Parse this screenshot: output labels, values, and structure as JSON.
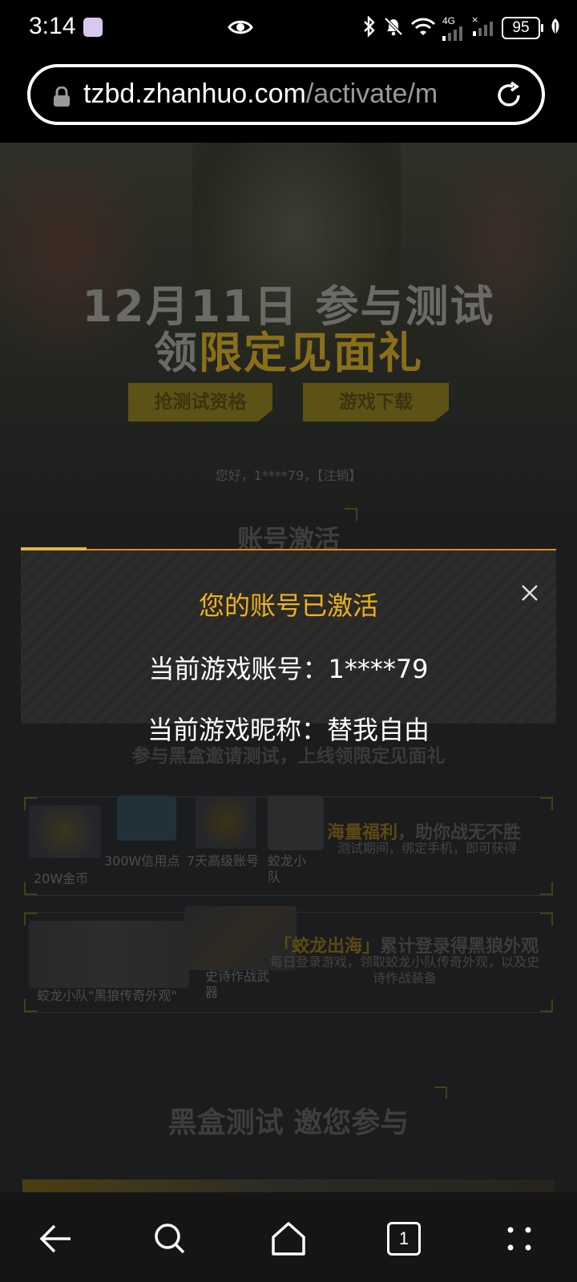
{
  "status_bar": {
    "time": "3:14",
    "battery": "95",
    "network_label": "4G",
    "icons": [
      "eye-icon",
      "bluetooth-icon",
      "mute-icon",
      "wifi-icon",
      "signal-icon",
      "signal-icon",
      "battery-icon",
      "leaf-icon"
    ]
  },
  "browser": {
    "url_host": "tzbd.zhanhuo.com",
    "url_path": "/activate/m",
    "tab_count": "1"
  },
  "page": {
    "headline_line1": "12月11日 参与测试",
    "headline_line2_prefix": "领",
    "headline_line2_gold": "限定见面礼",
    "cta_qualify": "抢测试资格",
    "cta_download": "游戏下载",
    "greeting": "您好，1****79，【注销】",
    "section_account_activation": "账号激活",
    "invite_title": "参与黑盒邀请测试，上线领限定见面礼",
    "rewards1": {
      "items": [
        "20W金币",
        "300W信用点",
        "7天高级账号",
        "蛟龙小队"
      ],
      "title_highlight": "海量福利",
      "title_rest": "，助你战无不胜",
      "desc": "测试期间，绑定手机，即可获得"
    },
    "rewards2": {
      "items": [
        "蛟龙小队\"黑狼传奇外观\"",
        "史诗作战武器"
      ],
      "title_highlight": "「蛟龙出海」",
      "title_rest": "累计登录得黑狼外观",
      "desc": "每日登录游戏，领取蛟龙小队传奇外观，以及史诗作战装备"
    },
    "section_black_box": "黑盒测试 邀您参与"
  },
  "dialog": {
    "title": "您的账号已激活",
    "account_line": "当前游戏账号：1****79",
    "nickname_line": "当前游戏昵称：替我自由"
  },
  "colors": {
    "accent_gold": "#f0b21a",
    "accent_orange": "#e58a14",
    "page_bg": "#1a1c1e"
  }
}
